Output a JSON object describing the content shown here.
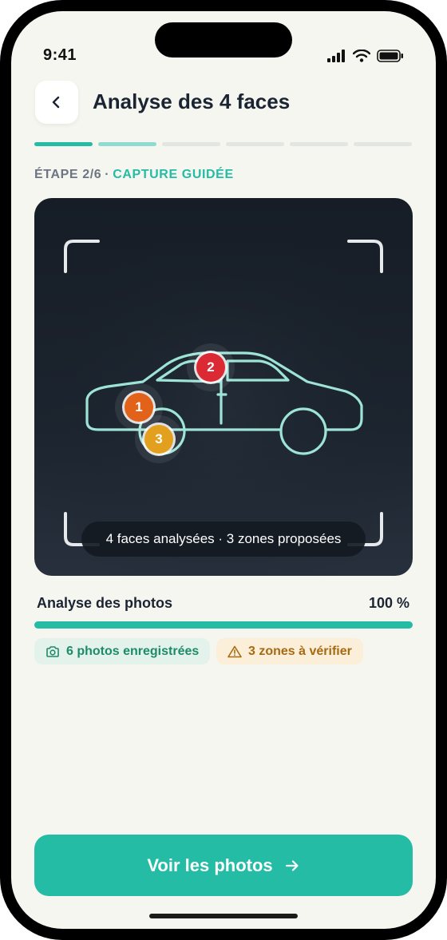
{
  "status_bar": {
    "time": "9:41"
  },
  "header": {
    "title": "Analyse des 4 faces"
  },
  "stepper": {
    "label_step": "ÉTAPE 2/6",
    "separator": "·",
    "label_name": "CAPTURE GUIDÉE",
    "total_steps": 6,
    "current_step": 2
  },
  "camera": {
    "caption": "4 faces analysées · 3 zones proposées",
    "markers": [
      {
        "label": "1",
        "color": "#e2621a"
      },
      {
        "label": "2",
        "color": "#dc2a35"
      },
      {
        "label": "3",
        "color": "#e3a01e"
      }
    ]
  },
  "analysis": {
    "label": "Analyse des photos",
    "value_text": "100 %",
    "progress": 1.0
  },
  "chips": {
    "photos": "6 photos enregistrées",
    "zones": "3 zones à vérifier"
  },
  "cta": {
    "label": "Voir les photos"
  },
  "icons": {
    "back": "chevron-left-icon",
    "camera": "camera-icon",
    "warning": "warning-icon",
    "arrow": "arrow-right-icon"
  },
  "colors": {
    "accent": "#24bca5",
    "background": "#f6f6f0",
    "title": "#1b2432"
  }
}
